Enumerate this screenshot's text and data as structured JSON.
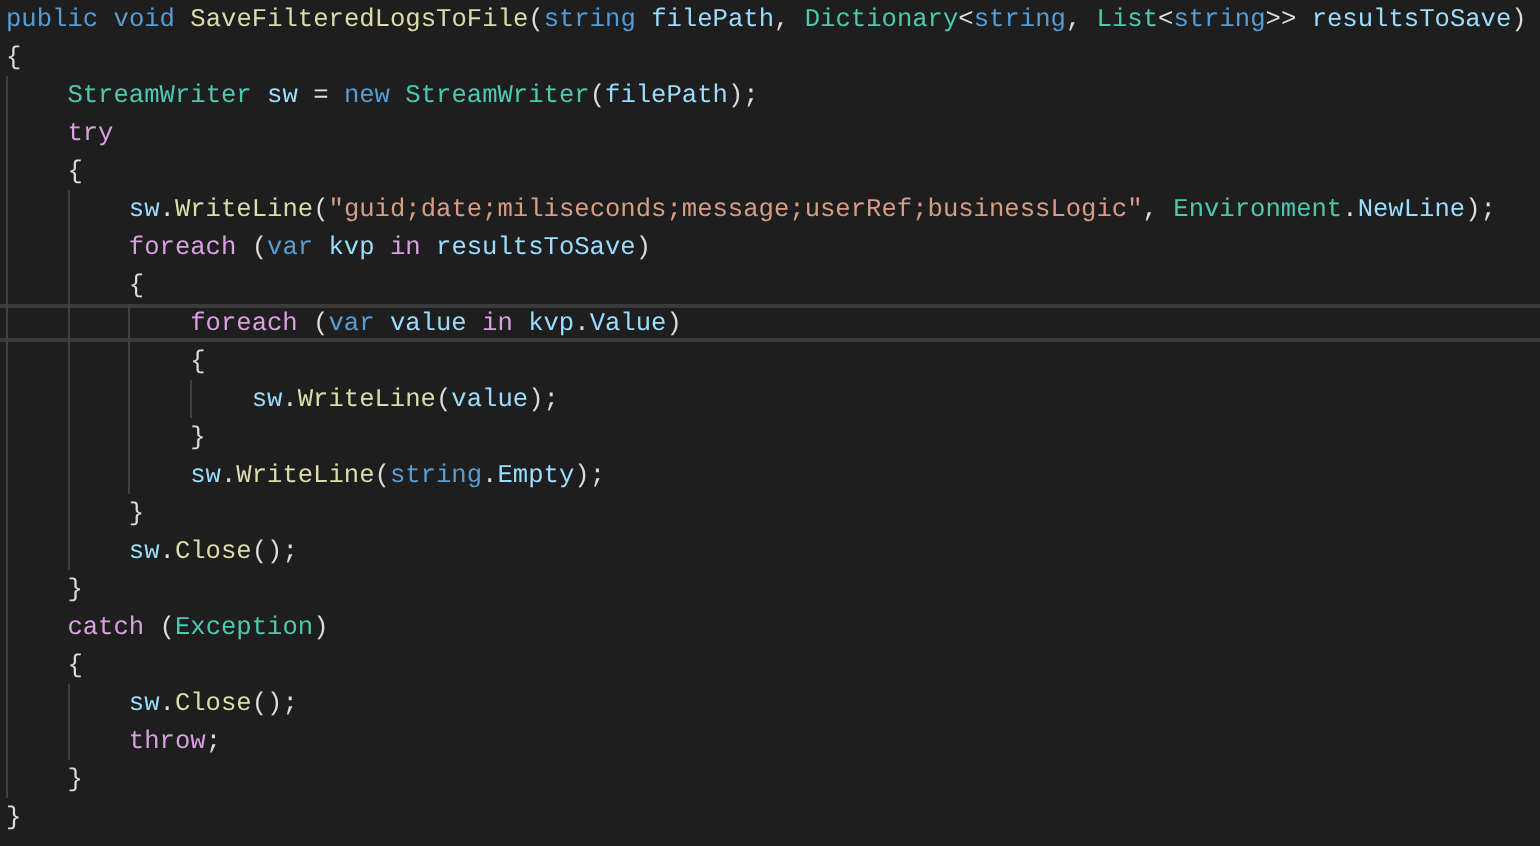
{
  "editor": {
    "lines": [
      {
        "current": false,
        "tokens": [
          {
            "kind": "kw",
            "text": "public "
          },
          {
            "kind": "kw",
            "text": "void "
          },
          {
            "kind": "method",
            "text": "SaveFilteredLogsToFile"
          },
          {
            "kind": "plain",
            "text": "("
          },
          {
            "kind": "kw",
            "text": "string "
          },
          {
            "kind": "var",
            "text": "filePath"
          },
          {
            "kind": "plain",
            "text": ", "
          },
          {
            "kind": "type",
            "text": "Dictionary"
          },
          {
            "kind": "plain",
            "text": "<"
          },
          {
            "kind": "kw",
            "text": "string"
          },
          {
            "kind": "plain",
            "text": ", "
          },
          {
            "kind": "type",
            "text": "List"
          },
          {
            "kind": "plain",
            "text": "<"
          },
          {
            "kind": "kw",
            "text": "string"
          },
          {
            "kind": "plain",
            "text": ">> "
          },
          {
            "kind": "var",
            "text": "resultsToSave"
          },
          {
            "kind": "plain",
            "text": ")"
          }
        ]
      },
      {
        "current": false,
        "tokens": [
          {
            "kind": "plain",
            "text": "{"
          }
        ]
      },
      {
        "current": false,
        "tokens": [
          {
            "kind": "type",
            "text": "    StreamWriter "
          },
          {
            "kind": "var",
            "text": "sw"
          },
          {
            "kind": "plain",
            "text": " = "
          },
          {
            "kind": "kw",
            "text": "new "
          },
          {
            "kind": "type",
            "text": "StreamWriter"
          },
          {
            "kind": "plain",
            "text": "("
          },
          {
            "kind": "var",
            "text": "filePath"
          },
          {
            "kind": "plain",
            "text": ");"
          }
        ]
      },
      {
        "current": false,
        "tokens": [
          {
            "kind": "ctrl",
            "text": "    try"
          }
        ]
      },
      {
        "current": false,
        "tokens": [
          {
            "kind": "plain",
            "text": "    {"
          }
        ]
      },
      {
        "current": false,
        "tokens": [
          {
            "kind": "var",
            "text": "        sw"
          },
          {
            "kind": "plain",
            "text": "."
          },
          {
            "kind": "method",
            "text": "WriteLine"
          },
          {
            "kind": "plain",
            "text": "("
          },
          {
            "kind": "str",
            "text": "\"guid;date;miliseconds;message;userRef;businessLogic\""
          },
          {
            "kind": "plain",
            "text": ", "
          },
          {
            "kind": "type",
            "text": "Environment"
          },
          {
            "kind": "plain",
            "text": "."
          },
          {
            "kind": "prop",
            "text": "NewLine"
          },
          {
            "kind": "plain",
            "text": ");"
          }
        ]
      },
      {
        "current": false,
        "tokens": [
          {
            "kind": "ctrl",
            "text": "        foreach"
          },
          {
            "kind": "plain",
            "text": " ("
          },
          {
            "kind": "kw",
            "text": "var "
          },
          {
            "kind": "var",
            "text": "kvp "
          },
          {
            "kind": "ctrl",
            "text": "in "
          },
          {
            "kind": "var",
            "text": "resultsToSave"
          },
          {
            "kind": "plain",
            "text": ")"
          }
        ]
      },
      {
        "current": false,
        "tokens": [
          {
            "kind": "plain",
            "text": "        {"
          }
        ]
      },
      {
        "current": true,
        "tokens": [
          {
            "kind": "ctrl",
            "text": "            foreach"
          },
          {
            "kind": "plain",
            "text": " ("
          },
          {
            "kind": "kw",
            "text": "var "
          },
          {
            "kind": "var",
            "text": "value "
          },
          {
            "kind": "ctrl",
            "text": "in "
          },
          {
            "kind": "var",
            "text": "kvp"
          },
          {
            "kind": "plain",
            "text": "."
          },
          {
            "kind": "prop",
            "text": "Value"
          },
          {
            "kind": "plain",
            "text": ")"
          }
        ]
      },
      {
        "current": false,
        "tokens": [
          {
            "kind": "plain",
            "text": "            {"
          }
        ]
      },
      {
        "current": false,
        "tokens": [
          {
            "kind": "var",
            "text": "                sw"
          },
          {
            "kind": "plain",
            "text": "."
          },
          {
            "kind": "method",
            "text": "WriteLine"
          },
          {
            "kind": "plain",
            "text": "("
          },
          {
            "kind": "var",
            "text": "value"
          },
          {
            "kind": "plain",
            "text": ");"
          }
        ]
      },
      {
        "current": false,
        "tokens": [
          {
            "kind": "plain",
            "text": "            }"
          }
        ]
      },
      {
        "current": false,
        "tokens": [
          {
            "kind": "var",
            "text": "            sw"
          },
          {
            "kind": "plain",
            "text": "."
          },
          {
            "kind": "method",
            "text": "WriteLine"
          },
          {
            "kind": "plain",
            "text": "("
          },
          {
            "kind": "kw",
            "text": "string"
          },
          {
            "kind": "plain",
            "text": "."
          },
          {
            "kind": "prop",
            "text": "Empty"
          },
          {
            "kind": "plain",
            "text": ");"
          }
        ]
      },
      {
        "current": false,
        "tokens": [
          {
            "kind": "plain",
            "text": "        }"
          }
        ]
      },
      {
        "current": false,
        "tokens": [
          {
            "kind": "var",
            "text": "        sw"
          },
          {
            "kind": "plain",
            "text": "."
          },
          {
            "kind": "method",
            "text": "Close"
          },
          {
            "kind": "plain",
            "text": "();"
          }
        ]
      },
      {
        "current": false,
        "tokens": [
          {
            "kind": "plain",
            "text": "    }"
          }
        ]
      },
      {
        "current": false,
        "tokens": [
          {
            "kind": "ctrl",
            "text": "    catch"
          },
          {
            "kind": "plain",
            "text": " ("
          },
          {
            "kind": "type",
            "text": "Exception"
          },
          {
            "kind": "plain",
            "text": ")"
          }
        ]
      },
      {
        "current": false,
        "tokens": [
          {
            "kind": "plain",
            "text": "    {"
          }
        ]
      },
      {
        "current": false,
        "tokens": [
          {
            "kind": "var",
            "text": "        sw"
          },
          {
            "kind": "plain",
            "text": "."
          },
          {
            "kind": "method",
            "text": "Close"
          },
          {
            "kind": "plain",
            "text": "();"
          }
        ]
      },
      {
        "current": false,
        "tokens": [
          {
            "kind": "ctrl",
            "text": "        throw"
          },
          {
            "kind": "plain",
            "text": ";"
          }
        ]
      },
      {
        "current": false,
        "tokens": [
          {
            "kind": "plain",
            "text": "    }"
          }
        ]
      },
      {
        "current": false,
        "tokens": [
          {
            "kind": "plain",
            "text": "}"
          }
        ]
      }
    ]
  }
}
